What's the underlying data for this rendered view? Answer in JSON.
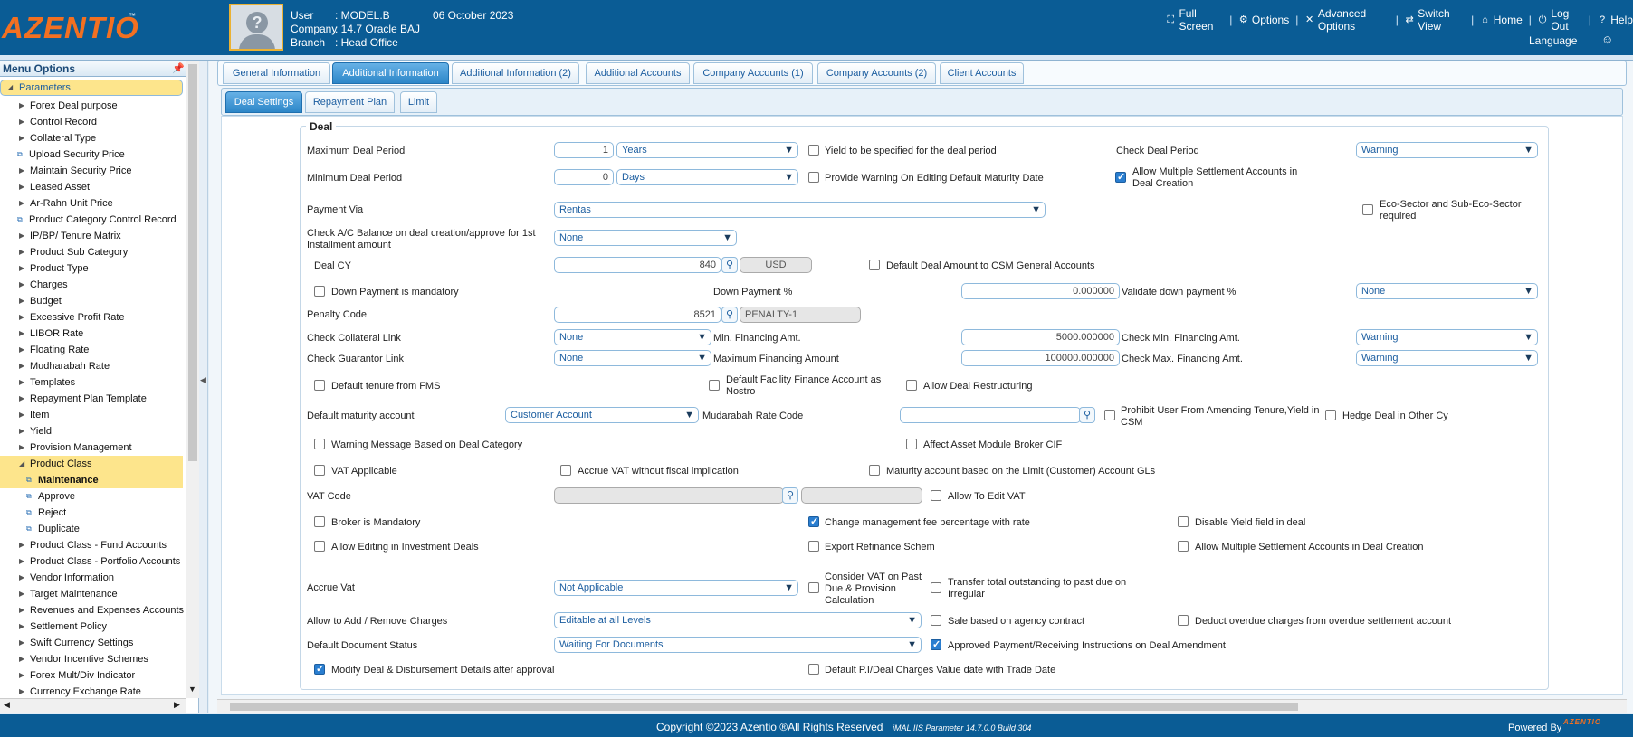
{
  "header": {
    "logo": "AZENTIO",
    "logo_tm": "™",
    "user_label": "User",
    "user_value": ": MODEL.B",
    "date": "06 October 2023",
    "company_label": "Company",
    "company_value": ": 14.7 Oracle BAJ",
    "branch_label": "Branch",
    "branch_value": ": Head Office",
    "language_label": "Language"
  },
  "topnav": {
    "full_screen": "Full Screen",
    "options": "Options",
    "advanced_options": "Advanced Options",
    "switch_view": "Switch View",
    "home": "Home",
    "log_out": "Log Out",
    "help": "Help"
  },
  "sidebar": {
    "title": "Menu Options",
    "parameters": "Parameters",
    "items": [
      "Forex Deal purpose",
      "Control Record",
      "Collateral Type",
      "Upload Security Price",
      "Maintain Security Price",
      "Leased Asset",
      "Ar-Rahn Unit Price",
      "Product Category Control Record",
      "IP/BP/ Tenure Matrix",
      "Product Sub Category",
      "Product Type",
      "Charges",
      "Budget",
      "Excessive Profit Rate",
      "LIBOR Rate",
      "Floating Rate",
      "Mudharabah Rate",
      "Templates",
      "Repayment Plan Template",
      "Item",
      "Yield",
      "Provision Management",
      "Product Class",
      "Maintenance",
      "Approve",
      "Reject",
      "Duplicate",
      "Product Class - Fund Accounts",
      "Product Class - Portfolio Accounts",
      "Vendor Information",
      "Target Maintenance",
      "Revenues and Expenses Accounts",
      "Settlement Policy",
      "Swift Currency Settings",
      "Vendor Incentive Schemes",
      "Forex Mult/Div Indicator",
      "Currency Exchange Rate"
    ]
  },
  "tabs": [
    "General Information",
    "Additional Information",
    "Additional Information (2)",
    "Additional Accounts",
    "Company Accounts (1)",
    "Company Accounts (2)",
    "Client Accounts"
  ],
  "subtabs": [
    "Deal Settings",
    "Repayment Plan",
    "Limit"
  ],
  "form": {
    "legend": "Deal",
    "max_deal_period_label": "Maximum Deal Period",
    "max_deal_period_value": "1",
    "max_deal_period_unit": "Years",
    "yield_specified_label": "Yield to be specified for the deal period",
    "check_deal_period_label": "Check Deal Period",
    "check_deal_period_value": "Warning",
    "min_deal_period_label": "Minimum Deal Period",
    "min_deal_period_value": "0",
    "min_deal_period_unit": "Days",
    "provide_warning_label": "Provide Warning On Editing Default Maturity Date",
    "allow_multi_settle_label": "Allow Multiple Settlement Accounts in Deal Creation",
    "payment_via_label": "Payment Via",
    "payment_via_value": "Rentas",
    "eco_sector_label": "Eco-Sector and Sub-Eco-Sector required",
    "check_ac_balance_label": "Check A/C Balance on deal creation/approve for 1st Installment amount",
    "check_ac_balance_value": "None",
    "deal_cy_label": "Deal CY",
    "deal_cy_value": "840",
    "deal_cy_code": "USD",
    "default_deal_amount_label": "Default Deal Amount to CSM General Accounts",
    "down_payment_mandatory_label": "Down Payment is mandatory",
    "down_payment_pct_label": "Down Payment %",
    "down_payment_pct_value": "0.000000",
    "validate_down_payment_label": "Validate down payment %",
    "validate_down_payment_value": "None",
    "penalty_code_label": "Penalty Code",
    "penalty_code_value": "8521",
    "penalty_code_desc": "PENALTY-1",
    "check_collateral_label": "Check Collateral Link",
    "check_collateral_value": "None",
    "min_financing_label": "Min. Financing Amt.",
    "min_financing_value": "5000.000000",
    "check_min_financing_label": "Check Min. Financing Amt.",
    "check_min_financing_value": "Warning",
    "check_guarantor_label": "Check Guarantor Link",
    "check_guarantor_value": "None",
    "max_financing_label": "Maximum Financing Amount",
    "max_financing_value": "100000.000000",
    "check_max_financing_label": "Check Max. Financing Amt.",
    "check_max_financing_value": "Warning",
    "default_tenure_label": "Default tenure from FMS",
    "default_facility_label": "Default Facility Finance Account as Nostro",
    "allow_restructuring_label": "Allow Deal Restructuring",
    "default_maturity_label": "Default maturity account",
    "default_maturity_value": "Customer Account",
    "mudarabah_label": "Mudarabah Rate Code",
    "mudarabah_value": "",
    "prohibit_user_label": "Prohibit User From Amending Tenure,Yield in CSM",
    "hedge_deal_label": "Hedge Deal in Other Cy",
    "warning_message_label": "Warning Message Based on Deal Category",
    "affect_asset_label": "Affect Asset Module Broker CIF",
    "vat_applicable_label": "VAT Applicable",
    "accrue_vat_without_label": "Accrue VAT without fiscal implication",
    "maturity_account_label": "Maturity account based on the Limit (Customer) Account GLs",
    "vat_code_label": "VAT Code",
    "vat_code_value": "",
    "vat_code_desc": "",
    "allow_edit_vat_label": "Allow To Edit VAT",
    "broker_mandatory_label": "Broker is Mandatory",
    "change_mgmt_fee_label": "Change management fee percentage with rate",
    "disable_yield_label": "Disable Yield field in deal",
    "allow_editing_inv_label": "Allow Editing in Investment Deals",
    "export_refinance_label": "Export Refinance Schem",
    "allow_multi_settle2_label": "Allow Multiple Settlement Accounts in Deal Creation",
    "accrue_vat_label": "Accrue Vat",
    "accrue_vat_value": "Not Applicable",
    "consider_vat_label": "Consider VAT on Past Due & Provision Calculation",
    "transfer_total_label": "Transfer total outstanding to past due on Irregular",
    "allow_charges_label": "Allow to Add / Remove Charges",
    "allow_charges_value": "Editable at all Levels",
    "sale_based_label": "Sale based on agency contract",
    "deduct_overdue_label": "Deduct overdue charges from overdue settlement account",
    "default_doc_status_label": "Default Document Status",
    "default_doc_status_value": "Waiting For Documents",
    "approved_payment_label": "Approved Payment/Receiving Instructions on Deal Amendment",
    "modify_deal_label": "Modify Deal & Disbursement Details after approval",
    "default_pi_label": "Default P.I/Deal Charges Value date with Trade Date"
  },
  "footer": {
    "copyright": "Copyright ©2023 Azentio ®All Rights Reserved",
    "build": "iMAL IIS Parameter 14.7.0.0 Build 304",
    "powered_by": "Powered By",
    "powered_logo": "AZENTIO"
  },
  "colors": {
    "header_bg": "#0a5c95",
    "accent_orange": "#f37021",
    "tab_active": "#2c86c8",
    "selected_menu": "#fde58c"
  }
}
